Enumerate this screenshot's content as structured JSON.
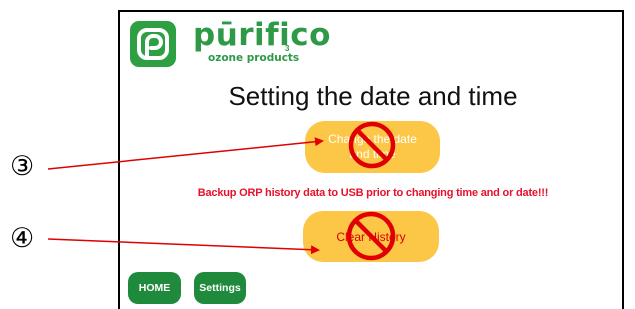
{
  "logo": {
    "brand": "pūrifico",
    "subtitle": "ozone products",
    "mark": "3",
    "brand_color": "#2e9a47"
  },
  "screen": {
    "title": "Setting the date and time",
    "change_button_label": "Change the date and time",
    "warning": "Backup ORP history data to USB prior to changing time and or date!!!",
    "clear_button_label": "Clear History",
    "home_label": "HOME",
    "settings_label": "Settings"
  },
  "annotations": {
    "marker_3": "③",
    "marker_4": "④",
    "arrow_color": "#e00000",
    "prohibited_icon": "no-entry-icon"
  },
  "colors": {
    "button_yellow": "#fcc646",
    "nav_green": "#1f8a3b",
    "warning_red": "#e8102b"
  }
}
